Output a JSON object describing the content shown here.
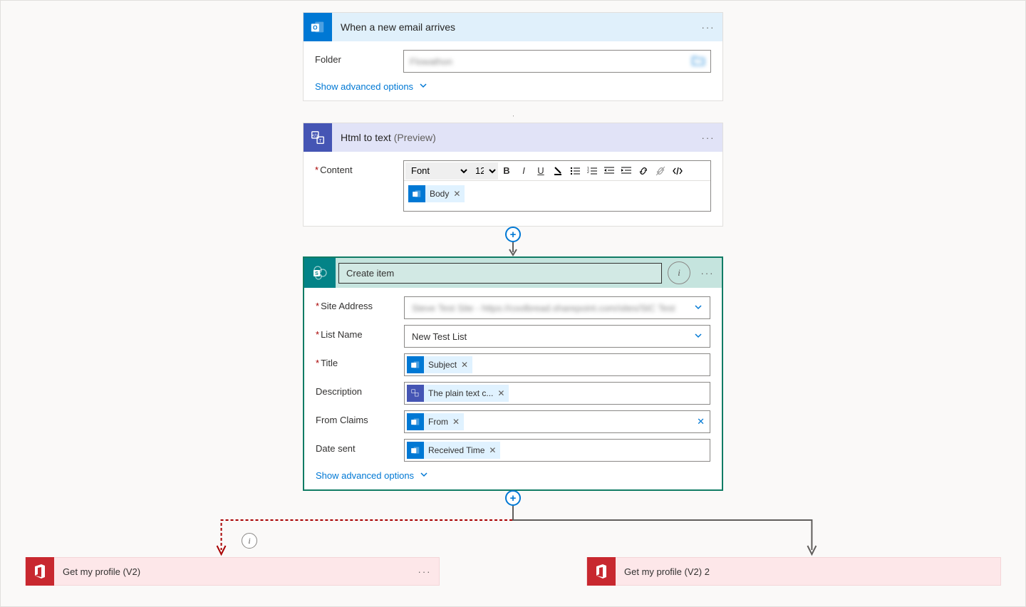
{
  "trigger": {
    "title": "When a new email arrives",
    "folder_label": "Folder",
    "folder_value": "Flowathon",
    "advanced": "Show advanced options"
  },
  "html_to_text": {
    "title": "Html to text",
    "preview": "(Preview)",
    "content_label": "Content",
    "font_label": "Font",
    "font_size": "12",
    "token": "Body"
  },
  "create_item": {
    "title": "Create item",
    "site_label": "Site Address",
    "site_value": "Steve Test Site - https://coolbread.sharepoint.com/sites/StC Test",
    "list_label": "List Name",
    "list_value": "New Test List",
    "title_label": "Title",
    "title_token": "Subject",
    "desc_label": "Description",
    "desc_token": "The plain text c...",
    "from_label": "From Claims",
    "from_token": "From",
    "date_label": "Date sent",
    "date_token": "Received Time",
    "advanced": "Show advanced options"
  },
  "branch_left": {
    "title": "Get my profile (V2)"
  },
  "branch_right": {
    "title": "Get my profile (V2) 2"
  }
}
